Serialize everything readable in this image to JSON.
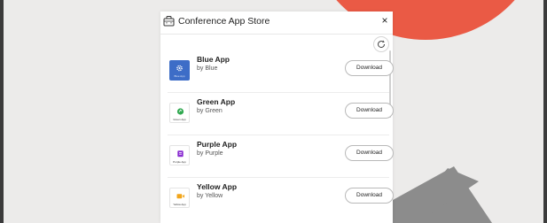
{
  "dialog": {
    "title": "Conference App Store",
    "close_label": "×",
    "icons": {
      "title": "store-icon",
      "close": "close-icon",
      "refresh": "refresh-icon"
    }
  },
  "apps": [
    {
      "name": "Blue App",
      "by": "by Blue",
      "icon_caption": "Blue App",
      "icon": "gear-icon",
      "color": "#3d6dc7",
      "download_label": "Download"
    },
    {
      "name": "Green App",
      "by": "by Green",
      "icon_caption": "Green App",
      "icon": "leaf-icon",
      "color": "#2fa84f",
      "download_label": "Download"
    },
    {
      "name": "Purple App",
      "by": "by Purple",
      "icon_caption": "Purple App",
      "icon": "document-icon",
      "color": "#8a2ed1",
      "download_label": "Download"
    },
    {
      "name": "Yellow App",
      "by": "by Yellow",
      "icon_caption": "Yellow App",
      "icon": "video-icon",
      "color": "#f2a51a",
      "download_label": "Download"
    }
  ],
  "background": {
    "accent": "#ea5a45",
    "stripe": "#8c8c8c",
    "base": "#ecebea"
  }
}
